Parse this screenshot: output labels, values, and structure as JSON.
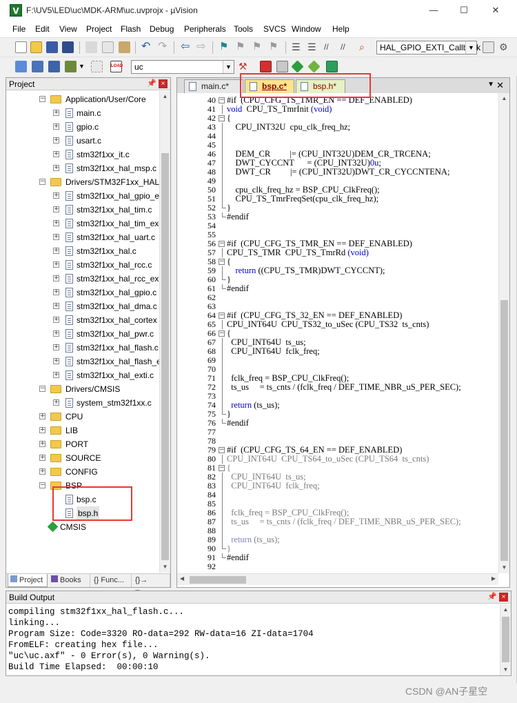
{
  "window": {
    "title": "F:\\UV5\\LED\\uc\\MDK-ARM\\uc.uvprojx - µVision",
    "minimize": "—",
    "maximize": "☐",
    "close": "✕"
  },
  "menu": [
    "File",
    "Edit",
    "View",
    "Project",
    "Flash",
    "Debug",
    "Peripherals",
    "Tools",
    "SVCS",
    "Window",
    "Help"
  ],
  "toolbar": {
    "function_combo": "HAL_GPIO_EXTI_Callback",
    "target_combo": "uc",
    "load_label": "LOAD"
  },
  "project_pane": {
    "title": "Project",
    "pin": "⌂",
    "close": "×",
    "tree": [
      {
        "label": "Application/User/Core",
        "type": "folder",
        "expanded": true,
        "level": 1
      },
      {
        "label": "main.c",
        "type": "file",
        "level": 2
      },
      {
        "label": "gpio.c",
        "type": "file",
        "level": 2
      },
      {
        "label": "usart.c",
        "type": "file",
        "level": 2
      },
      {
        "label": "stm32f1xx_it.c",
        "type": "file",
        "level": 2
      },
      {
        "label": "stm32f1xx_hal_msp.c",
        "type": "file",
        "level": 2
      },
      {
        "label": "Drivers/STM32F1xx_HAL_",
        "type": "folder",
        "expanded": true,
        "level": 1
      },
      {
        "label": "stm32f1xx_hal_gpio_e",
        "type": "file",
        "level": 2
      },
      {
        "label": "stm32f1xx_hal_tim.c",
        "type": "file",
        "level": 2
      },
      {
        "label": "stm32f1xx_hal_tim_ex",
        "type": "file",
        "level": 2
      },
      {
        "label": "stm32f1xx_hal_uart.c",
        "type": "file",
        "level": 2
      },
      {
        "label": "stm32f1xx_hal.c",
        "type": "file",
        "level": 2
      },
      {
        "label": "stm32f1xx_hal_rcc.c",
        "type": "file",
        "level": 2
      },
      {
        "label": "stm32f1xx_hal_rcc_ex",
        "type": "file",
        "level": 2
      },
      {
        "label": "stm32f1xx_hal_gpio.c",
        "type": "file",
        "level": 2
      },
      {
        "label": "stm32f1xx_hal_dma.c",
        "type": "file",
        "level": 2
      },
      {
        "label": "stm32f1xx_hal_cortex",
        "type": "file",
        "level": 2
      },
      {
        "label": "stm32f1xx_hal_pwr.c",
        "type": "file",
        "level": 2
      },
      {
        "label": "stm32f1xx_hal_flash.c",
        "type": "file",
        "level": 2
      },
      {
        "label": "stm32f1xx_hal_flash_e",
        "type": "file",
        "level": 2
      },
      {
        "label": "stm32f1xx_hal_exti.c",
        "type": "file",
        "level": 2
      },
      {
        "label": "Drivers/CMSIS",
        "type": "folder",
        "expanded": true,
        "level": 1
      },
      {
        "label": "system_stm32f1xx.c",
        "type": "file",
        "level": 2
      },
      {
        "label": "CPU",
        "type": "folder",
        "expanded": false,
        "level": 1
      },
      {
        "label": "LIB",
        "type": "folder",
        "expanded": false,
        "level": 1
      },
      {
        "label": "PORT",
        "type": "folder",
        "expanded": false,
        "level": 1
      },
      {
        "label": "SOURCE",
        "type": "folder",
        "expanded": false,
        "level": 1
      },
      {
        "label": "CONFIG",
        "type": "folder",
        "expanded": false,
        "level": 1
      },
      {
        "label": "BSP",
        "type": "folder",
        "expanded": true,
        "level": 1
      },
      {
        "label": "bsp.c",
        "type": "file",
        "level": 2,
        "noexpander": true
      },
      {
        "label": "bsp.h",
        "type": "file",
        "level": 2,
        "noexpander": true,
        "selected": true
      },
      {
        "label": "CMSIS",
        "type": "gem",
        "level": 1
      }
    ],
    "tabs": [
      "Project",
      "Books",
      "{} Func...",
      "{}→ Temp..."
    ]
  },
  "editor": {
    "tabs": [
      {
        "label": "main.c*",
        "state": "plain"
      },
      {
        "label": "bsp.c*",
        "state": "active"
      },
      {
        "label": "bsp.h*",
        "state": "inactive"
      }
    ],
    "lines": [
      {
        "n": 40,
        "text": "#if  (CPU_CFG_TS_TMR_EN == DEF_ENABLED)",
        "fold": "box-",
        "dim": false
      },
      {
        "n": 41,
        "text": "void  CPU_TS_TmrInit (void)",
        "fold": "bar",
        "dim": false
      },
      {
        "n": 42,
        "text": "{",
        "fold": "box-",
        "dim": false
      },
      {
        "n": 43,
        "text": "    CPU_INT32U  cpu_clk_freq_hz;",
        "fold": "bar",
        "dim": false
      },
      {
        "n": 44,
        "text": "",
        "fold": "bar",
        "dim": false
      },
      {
        "n": 45,
        "text": "",
        "fold": "bar",
        "dim": false
      },
      {
        "n": 46,
        "text": "    DEM_CR         |= (CPU_INT32U)DEM_CR_TRCENA;",
        "fold": "bar",
        "dim": false
      },
      {
        "n": 47,
        "text": "    DWT_CYCCNT      = (CPU_INT32U)0u;",
        "fold": "bar",
        "dim": false
      },
      {
        "n": 48,
        "text": "    DWT_CR         |= (CPU_INT32U)DWT_CR_CYCCNTENA;",
        "fold": "bar",
        "dim": false
      },
      {
        "n": 49,
        "text": "",
        "fold": "bar",
        "dim": false
      },
      {
        "n": 50,
        "text": "    cpu_clk_freq_hz = BSP_CPU_ClkFreq();",
        "fold": "bar",
        "dim": false
      },
      {
        "n": 51,
        "text": "    CPU_TS_TmrFreqSet(cpu_clk_freq_hz);",
        "fold": "bar",
        "dim": false
      },
      {
        "n": 52,
        "text": "}",
        "fold": "end",
        "dim": false
      },
      {
        "n": 53,
        "text": "#endif",
        "fold": "end",
        "dim": false
      },
      {
        "n": 54,
        "text": "",
        "fold": "",
        "dim": false
      },
      {
        "n": 55,
        "text": "",
        "fold": "",
        "dim": false
      },
      {
        "n": 56,
        "text": "#if  (CPU_CFG_TS_TMR_EN == DEF_ENABLED)",
        "fold": "box-",
        "dim": false
      },
      {
        "n": 57,
        "text": "CPU_TS_TMR  CPU_TS_TmrRd (void)",
        "fold": "bar",
        "dim": false
      },
      {
        "n": 58,
        "text": "{",
        "fold": "box-",
        "dim": false
      },
      {
        "n": 59,
        "text": "    return ((CPU_TS_TMR)DWT_CYCCNT);",
        "fold": "bar",
        "dim": false
      },
      {
        "n": 60,
        "text": "}",
        "fold": "end",
        "dim": false
      },
      {
        "n": 61,
        "text": "#endif",
        "fold": "end",
        "dim": false
      },
      {
        "n": 62,
        "text": "",
        "fold": "",
        "dim": false
      },
      {
        "n": 63,
        "text": "",
        "fold": "",
        "dim": false
      },
      {
        "n": 64,
        "text": "#if  (CPU_CFG_TS_32_EN == DEF_ENABLED)",
        "fold": "box-",
        "dim": false
      },
      {
        "n": 65,
        "text": "CPU_INT64U  CPU_TS32_to_uSec (CPU_TS32  ts_cnts)",
        "fold": "bar",
        "dim": false
      },
      {
        "n": 66,
        "text": "{",
        "fold": "box-",
        "dim": false
      },
      {
        "n": 67,
        "text": "  CPU_INT64U  ts_us;",
        "fold": "bar",
        "dim": false
      },
      {
        "n": 68,
        "text": "  CPU_INT64U  fclk_freq;",
        "fold": "bar",
        "dim": false
      },
      {
        "n": 69,
        "text": "",
        "fold": "bar",
        "dim": false
      },
      {
        "n": 70,
        "text": "",
        "fold": "bar",
        "dim": false
      },
      {
        "n": 71,
        "text": "  fclk_freq = BSP_CPU_ClkFreq();",
        "fold": "bar",
        "dim": false
      },
      {
        "n": 72,
        "text": "  ts_us     = ts_cnts / (fclk_freq / DEF_TIME_NBR_uS_PER_SEC);",
        "fold": "bar",
        "dim": false
      },
      {
        "n": 73,
        "text": "",
        "fold": "bar",
        "dim": false
      },
      {
        "n": 74,
        "text": "  return (ts_us);",
        "fold": "bar",
        "dim": false
      },
      {
        "n": 75,
        "text": "}",
        "fold": "end",
        "dim": false
      },
      {
        "n": 76,
        "text": "#endif",
        "fold": "end",
        "dim": false
      },
      {
        "n": 77,
        "text": "",
        "fold": "",
        "dim": false
      },
      {
        "n": 78,
        "text": "",
        "fold": "",
        "dim": false
      },
      {
        "n": 79,
        "text": "#if  (CPU_CFG_TS_64_EN == DEF_ENABLED)",
        "fold": "box-",
        "dim": false
      },
      {
        "n": 80,
        "text": "CPU_INT64U  CPU_TS64_to_uSec (CPU_TS64  ts_cnts)",
        "fold": "bar",
        "dim": true
      },
      {
        "n": 81,
        "text": "{",
        "fold": "box-",
        "dim": true
      },
      {
        "n": 82,
        "text": "  CPU_INT64U  ts_us;",
        "fold": "bar",
        "dim": true
      },
      {
        "n": 83,
        "text": "  CPU_INT64U  fclk_freq;",
        "fold": "bar",
        "dim": true
      },
      {
        "n": 84,
        "text": "",
        "fold": "bar",
        "dim": true
      },
      {
        "n": 85,
        "text": "",
        "fold": "bar",
        "dim": true
      },
      {
        "n": 86,
        "text": "  fclk_freq = BSP_CPU_ClkFreq();",
        "fold": "bar",
        "dim": true
      },
      {
        "n": 87,
        "text": "  ts_us     = ts_cnts / (fclk_freq / DEF_TIME_NBR_uS_PER_SEC);",
        "fold": "bar",
        "dim": true
      },
      {
        "n": 88,
        "text": "",
        "fold": "bar",
        "dim": true
      },
      {
        "n": 89,
        "text": "  return (ts_us);",
        "fold": "bar",
        "dim": true
      },
      {
        "n": 90,
        "text": "}",
        "fold": "end",
        "dim": true
      },
      {
        "n": 91,
        "text": "#endif",
        "fold": "end",
        "dim": false
      },
      {
        "n": 92,
        "text": "",
        "fold": "",
        "dim": false
      }
    ]
  },
  "build_output": {
    "title": "Build Output",
    "lines": [
      "compiling stm32f1xx_hal_flash.c...",
      "linking...",
      "Program Size: Code=3320 RO-data=292 RW-data=16 ZI-data=1704",
      "FromELF: creating hex file...",
      "\"uc\\uc.axf\" - 0 Error(s), 0 Warning(s).",
      "Build Time Elapsed:  00:00:10"
    ]
  },
  "watermark": "CSDN @AN子星空",
  "colors": {
    "highlight_box": "#e53935",
    "active_tab": "#fbe48c",
    "inactive_tab": "#e6f1c4",
    "keyword": "#0000cc"
  }
}
